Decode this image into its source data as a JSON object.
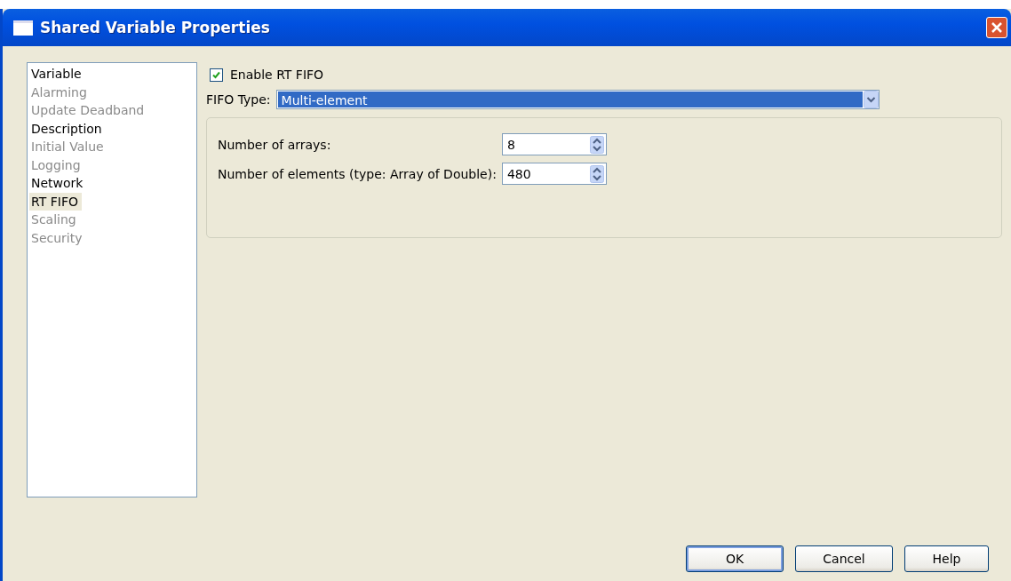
{
  "window": {
    "title": "Shared Variable Properties"
  },
  "sidebar": {
    "items": [
      {
        "label": "Variable",
        "disabled": false,
        "selected": false
      },
      {
        "label": "Alarming",
        "disabled": true,
        "selected": false
      },
      {
        "label": "Update Deadband",
        "disabled": true,
        "selected": false
      },
      {
        "label": "Description",
        "disabled": false,
        "selected": false
      },
      {
        "label": "Initial Value",
        "disabled": true,
        "selected": false
      },
      {
        "label": "Logging",
        "disabled": true,
        "selected": false
      },
      {
        "label": "Network",
        "disabled": false,
        "selected": false
      },
      {
        "label": "RT FIFO",
        "disabled": false,
        "selected": true
      },
      {
        "label": "Scaling",
        "disabled": true,
        "selected": false
      },
      {
        "label": "Security",
        "disabled": true,
        "selected": false
      }
    ]
  },
  "enable_checkbox": {
    "label": "Enable RT FIFO",
    "checked": true
  },
  "fifo_type": {
    "label": "FIFO Type:",
    "value": "Multi-element"
  },
  "fields": [
    {
      "label": "Number of arrays:",
      "value": "8"
    },
    {
      "label": "Number of elements (type: Array of Double):",
      "value": "480"
    }
  ],
  "buttons": [
    {
      "label": "OK",
      "default": true
    },
    {
      "label": "Cancel",
      "default": false
    },
    {
      "label": "Help",
      "default": false
    }
  ]
}
